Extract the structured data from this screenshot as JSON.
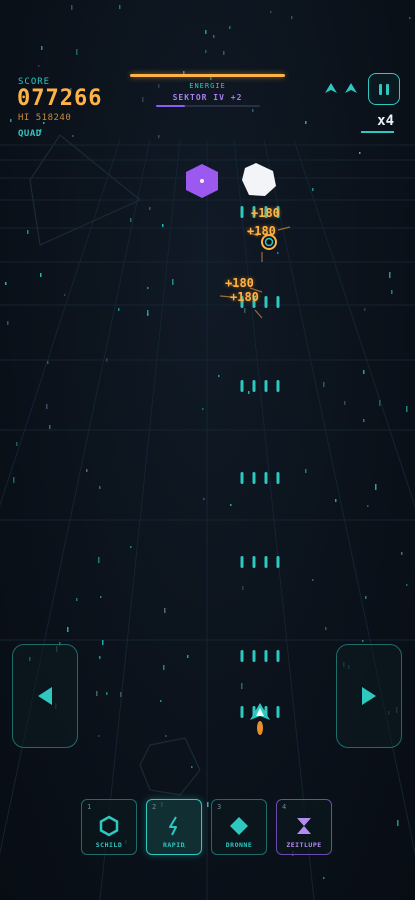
{
  "hud": {
    "score_label": "SCORE",
    "score": "077266",
    "hi_score": "HI 518240",
    "weapon_mode": "QUAD",
    "energy_label": "ENERGIE",
    "energy_fraction": 1.0,
    "sector_label": "SEKTOR IV +2",
    "sector_progress": 0.28,
    "lives": 2,
    "multiplier": "x4"
  },
  "popups": [
    "+180",
    "+180",
    "+180",
    "+180"
  ],
  "powerups": [
    {
      "key": "1",
      "label": "SCHILD",
      "icon": "hexagon-icon",
      "active": false,
      "color": "#2ec8c0"
    },
    {
      "key": "2",
      "label": "RAPID",
      "icon": "lightning-icon",
      "active": true,
      "color": "#2ec8c0"
    },
    {
      "key": "3",
      "label": "DRONNE",
      "icon": "diamond-icon",
      "active": false,
      "color": "#2ec8c0"
    },
    {
      "key": "4",
      "label": "ZEITLUPE",
      "icon": "hourglass-icon",
      "active": false,
      "color": "#b48cf0"
    }
  ],
  "colors": {
    "accent": "#2ec8c0",
    "score": "#ffb347",
    "sector": "#8b5cf6",
    "enemy_purple": "#9b59f0",
    "enemy_white": "#f2f4f8"
  }
}
